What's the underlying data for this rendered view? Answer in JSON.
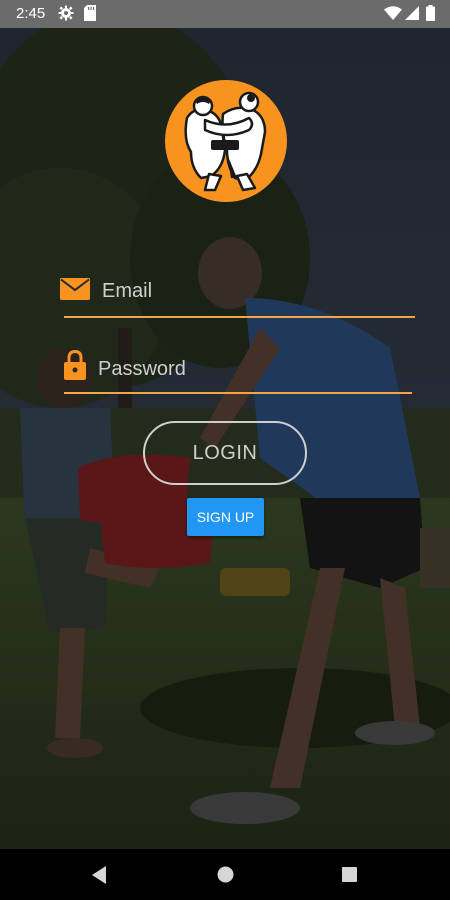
{
  "status_bar": {
    "time": "2:45",
    "icons": [
      "gear-icon",
      "sd-card-icon",
      "wifi-icon",
      "signal-icon",
      "battery-icon"
    ]
  },
  "logo": {
    "icon": "fighters-logo-icon",
    "background_color": "#f7931e"
  },
  "form": {
    "email_placeholder": "Email",
    "password_placeholder": "Password",
    "email_value": "",
    "password_value": "",
    "email_icon": "envelope-icon",
    "password_icon": "lock-icon",
    "accent_color": "#f0a54a"
  },
  "buttons": {
    "login_label": "LOGIN",
    "signup_label": "SIGN UP",
    "signup_color": "#2196f3"
  },
  "nav_bar": {
    "icons": [
      "back-icon",
      "home-icon",
      "recents-icon"
    ]
  }
}
